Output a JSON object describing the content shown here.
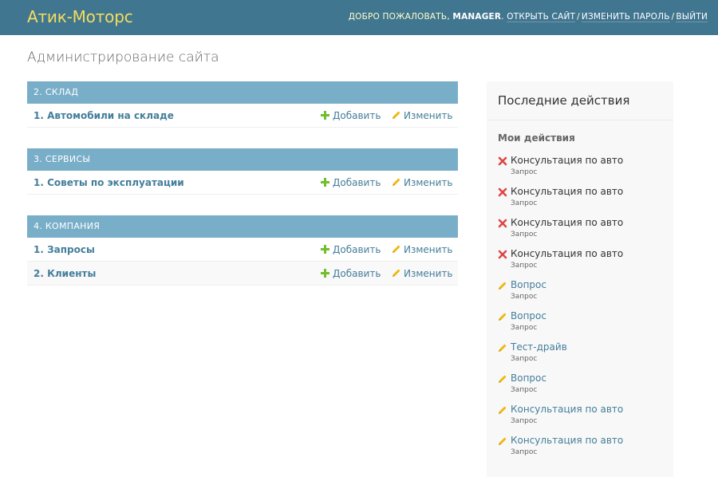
{
  "header": {
    "branding": "Атик-Моторс",
    "welcome": "ДОБРО ПОЖАЛОВАТЬ,",
    "username": "MANAGER",
    "links": [
      "ОТКРЫТЬ САЙТ",
      "ИЗМЕНИТЬ ПАРОЛЬ",
      "ВЫЙТИ"
    ]
  },
  "page_title": "Администрирование сайта",
  "modules": [
    {
      "caption": "2. СКЛАД",
      "models": [
        {
          "name": "1. Автомобили на складе",
          "add": "Добавить",
          "change": "Изменить"
        }
      ]
    },
    {
      "caption": "3. СЕРВИСЫ",
      "models": [
        {
          "name": "1. Советы по эксплуатации",
          "add": "Добавить",
          "change": "Изменить"
        }
      ]
    },
    {
      "caption": "4. КОМПАНИЯ",
      "models": [
        {
          "name": "1. Запросы",
          "add": "Добавить",
          "change": "Изменить"
        },
        {
          "name": "2. Клиенты",
          "add": "Добавить",
          "change": "Изменить"
        }
      ]
    }
  ],
  "recent": {
    "title": "Последние действия",
    "subtitle": "Мои действия",
    "actions": [
      {
        "type": "deleted",
        "icon": "delete-icon",
        "title": "Консультация по авто",
        "model": "Запрос"
      },
      {
        "type": "deleted",
        "icon": "delete-icon",
        "title": "Консультация по авто",
        "model": "Запрос"
      },
      {
        "type": "deleted",
        "icon": "delete-icon",
        "title": "Консультация по авто",
        "model": "Запрос"
      },
      {
        "type": "deleted",
        "icon": "delete-icon",
        "title": "Консультация по авто",
        "model": "Запрос"
      },
      {
        "type": "changed",
        "icon": "pencil-icon",
        "title": "Вопрос",
        "model": "Запрос"
      },
      {
        "type": "changed",
        "icon": "pencil-icon",
        "title": "Вопрос",
        "model": "Запрос"
      },
      {
        "type": "changed",
        "icon": "pencil-icon",
        "title": "Тест-драйв",
        "model": "Запрос"
      },
      {
        "type": "changed",
        "icon": "pencil-icon",
        "title": "Вопрос",
        "model": "Запрос"
      },
      {
        "type": "changed",
        "icon": "pencil-icon",
        "title": "Консультация по авто",
        "model": "Запрос"
      },
      {
        "type": "changed",
        "icon": "pencil-icon",
        "title": "Консультация по авто",
        "model": "Запрос"
      }
    ]
  },
  "colors": {
    "header_bg": "#417690",
    "branding": "#f5dd5d",
    "caption_bg": "#79aec8",
    "link": "#447e9b",
    "add_green": "#70bf2b",
    "delete_red": "#dd4646",
    "pencil_yellow": "#efb80b"
  }
}
